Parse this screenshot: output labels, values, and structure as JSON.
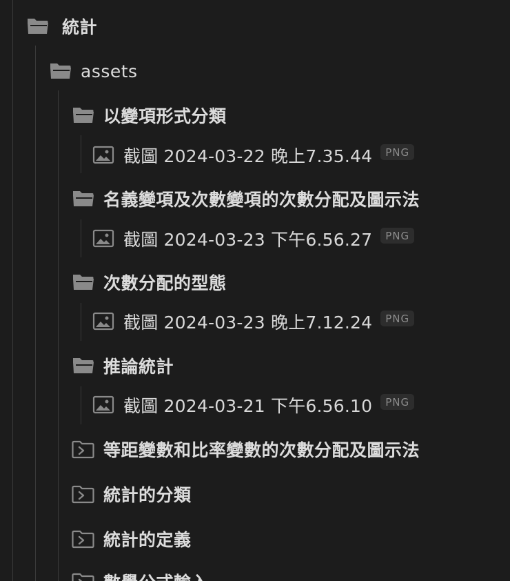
{
  "tree": {
    "root": {
      "label": "統計",
      "icon": "folder-open-icon"
    },
    "assets": {
      "label": "assets",
      "icon": "folder-open-icon"
    },
    "groups": [
      {
        "label": "以變項形式分類",
        "icon": "folder-open-icon",
        "file": {
          "name": "截圖 2024-03-22 晚上7.35.44",
          "ext": "PNG",
          "icon": "image-icon"
        }
      },
      {
        "label": "名義變項及次數變項的次數分配及圖示法",
        "icon": "folder-open-icon",
        "file": {
          "name": "截圖 2024-03-23 下午6.56.27",
          "ext": "PNG",
          "icon": "image-icon"
        }
      },
      {
        "label": "次數分配的型態",
        "icon": "folder-open-icon",
        "file": {
          "name": "截圖 2024-03-23 晚上7.12.24",
          "ext": "PNG",
          "icon": "image-icon"
        }
      },
      {
        "label": "推論統計",
        "icon": "folder-open-icon",
        "file": {
          "name": "截圖 2024-03-21 下午6.56.10",
          "ext": "PNG",
          "icon": "image-icon"
        }
      }
    ],
    "collapsed": [
      {
        "label": "等距變數和比率變數的次數分配及圖示法",
        "icon": "folder-collapsed-icon"
      },
      {
        "label": "統計的分類",
        "icon": "folder-collapsed-icon"
      },
      {
        "label": "統計的定義",
        "icon": "folder-collapsed-icon"
      },
      {
        "label": "數學公式輸入",
        "icon": "folder-collapsed-icon"
      }
    ]
  },
  "colors": {
    "background": "#1c1c1c",
    "text": "#d4d4d4",
    "icon": "#8a8a8a",
    "guide": "#3a3a3a",
    "badge_bg": "#2d2d2d",
    "badge_text": "#8c8c8c"
  }
}
